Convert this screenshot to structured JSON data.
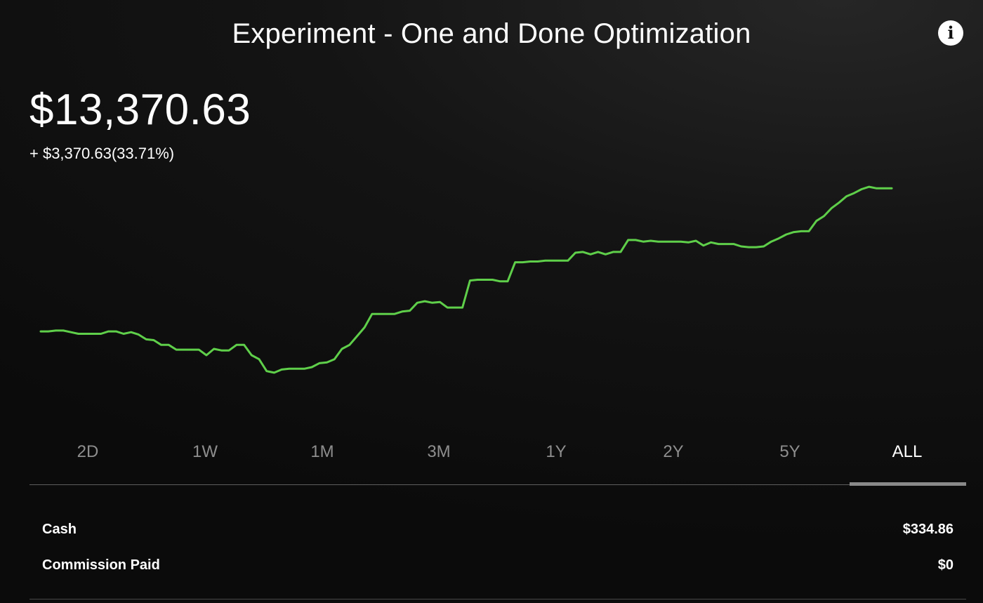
{
  "header": {
    "title": "Experiment - One and Done Optimization",
    "info_icon": "info-icon",
    "info_glyph": "i"
  },
  "summary": {
    "balance": "$13,370.63",
    "change": "+ $3,370.63(33.71%)"
  },
  "colors": {
    "line": "#5fcf4a",
    "background": "#121212",
    "muted_text": "#8e8e8e",
    "text": "#ffffff"
  },
  "range_tabs": {
    "items": [
      "2D",
      "1W",
      "1M",
      "3M",
      "1Y",
      "2Y",
      "5Y",
      "ALL"
    ],
    "active": "ALL"
  },
  "stats": {
    "cash_label": "Cash",
    "cash_value": "$334.86",
    "commission_label": "Commission Paid",
    "commission_value": "$0"
  },
  "chart_data": {
    "type": "line",
    "title": "",
    "xlabel": "",
    "ylabel": "",
    "grid": false,
    "series": [
      {
        "values": [
          10000,
          10000,
          10010,
          10010,
          9990,
          9970,
          9970,
          9970,
          9970,
          10000,
          10000,
          9970,
          9990,
          9960,
          9900,
          9890,
          9830,
          9830,
          9770,
          9770,
          9770,
          9770,
          9700,
          9780,
          9760,
          9760,
          9830,
          9830,
          9700,
          9650,
          9500,
          9480,
          9520,
          9530,
          9530,
          9530,
          9550,
          9600,
          9610,
          9650,
          9780,
          9830,
          9940,
          10050,
          10220,
          10220,
          10220,
          10220,
          10250,
          10260,
          10360,
          10380,
          10360,
          10370,
          10300,
          10300,
          10300,
          10640,
          10650,
          10650,
          10650,
          10630,
          10630,
          10870,
          10870,
          10880,
          10880,
          10890,
          10890,
          10890,
          10890,
          10990,
          11000,
          10970,
          11000,
          10970,
          11000,
          11000,
          11150,
          11150,
          11130,
          11140,
          11130,
          11130,
          11130,
          11130,
          11120,
          11140,
          11080,
          11120,
          11100,
          11100,
          11100,
          11070,
          11060,
          11060,
          11070,
          11130,
          11170,
          11220,
          11250,
          11260,
          11260,
          11390,
          11450,
          11550,
          11620,
          11700,
          11740,
          11790,
          11820,
          11800,
          11800,
          11800
        ]
      }
    ]
  }
}
